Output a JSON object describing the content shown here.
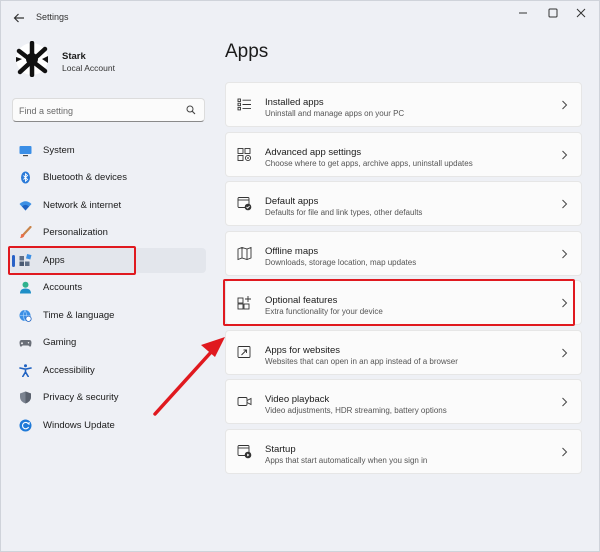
{
  "window": {
    "title": "Settings"
  },
  "profile": {
    "name": "Stark",
    "account_type": "Local Account"
  },
  "search": {
    "placeholder": "Find a setting"
  },
  "sidebar": {
    "items": [
      {
        "label": "System",
        "icon": "monitor-icon"
      },
      {
        "label": "Bluetooth & devices",
        "icon": "bluetooth-icon"
      },
      {
        "label": "Network & internet",
        "icon": "wifi-icon"
      },
      {
        "label": "Personalization",
        "icon": "brush-icon"
      },
      {
        "label": "Apps",
        "icon": "apps-icon",
        "selected": true
      },
      {
        "label": "Accounts",
        "icon": "person-icon"
      },
      {
        "label": "Time & language",
        "icon": "globe-clock-icon"
      },
      {
        "label": "Gaming",
        "icon": "gamepad-icon"
      },
      {
        "label": "Accessibility",
        "icon": "accessibility-icon"
      },
      {
        "label": "Privacy & security",
        "icon": "shield-icon"
      },
      {
        "label": "Windows Update",
        "icon": "update-icon"
      }
    ]
  },
  "main": {
    "title": "Apps",
    "cards": [
      {
        "title": "Installed apps",
        "subtitle": "Uninstall and manage apps on your PC",
        "icon": "list-icon"
      },
      {
        "title": "Advanced app settings",
        "subtitle": "Choose where to get apps, archive apps, uninstall updates",
        "icon": "app-settings-icon"
      },
      {
        "title": "Default apps",
        "subtitle": "Defaults for file and link types, other defaults",
        "icon": "default-apps-icon"
      },
      {
        "title": "Offline maps",
        "subtitle": "Downloads, storage location, map updates",
        "icon": "map-icon"
      },
      {
        "title": "Optional features",
        "subtitle": "Extra functionality for your device",
        "icon": "add-grid-icon"
      },
      {
        "title": "Apps for websites",
        "subtitle": "Websites that can open in an app instead of a browser",
        "icon": "web-app-icon"
      },
      {
        "title": "Video playback",
        "subtitle": "Video adjustments, HDR streaming, battery options",
        "icon": "video-icon"
      },
      {
        "title": "Startup",
        "subtitle": "Apps that start automatically when you sign in",
        "icon": "startup-icon"
      }
    ]
  },
  "colors": {
    "accent": "#2962c7",
    "annotation": "#e0191f"
  }
}
